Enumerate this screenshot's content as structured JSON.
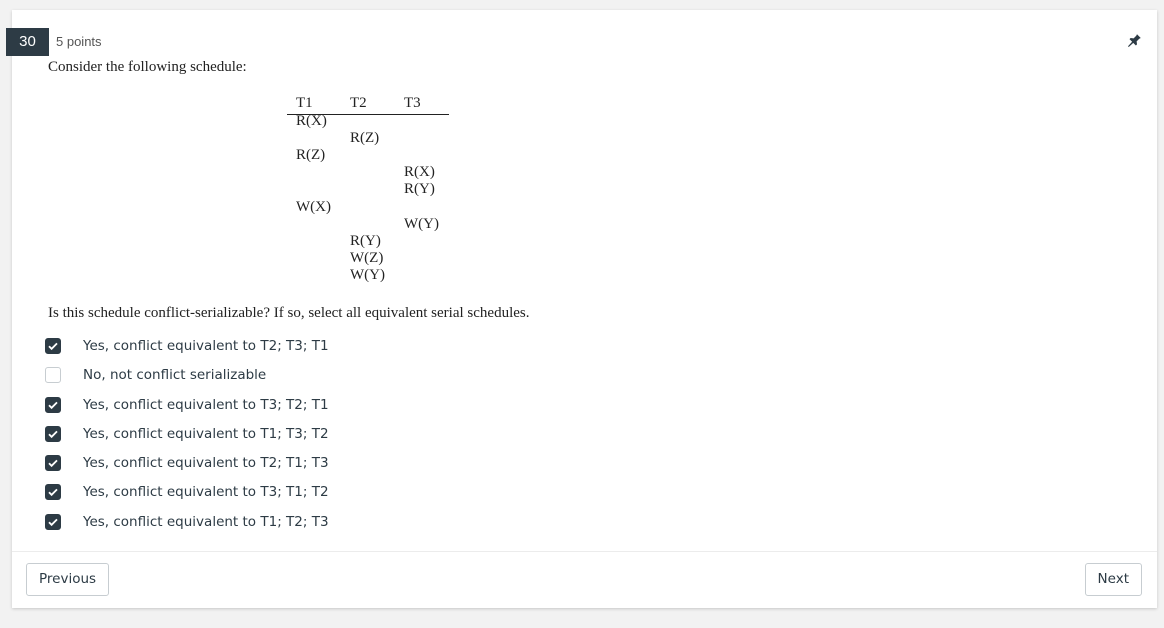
{
  "question": {
    "number": "30",
    "points": "5 points",
    "prompt": "Consider the following schedule:",
    "text": "Is this schedule conflict-serializable? If so, select all equivalent serial schedules."
  },
  "schedule": {
    "transactions": [
      "T1",
      "T2",
      "T3"
    ],
    "operations": [
      {
        "txn": "T1",
        "op": "R(X)"
      },
      {
        "txn": "T2",
        "op": "R(Z)"
      },
      {
        "txn": "T1",
        "op": "R(Z)"
      },
      {
        "txn": "T3",
        "op": "R(X)"
      },
      {
        "txn": "T3",
        "op": "R(Y)"
      },
      {
        "txn": "T1",
        "op": "W(X)"
      },
      {
        "txn": "T3",
        "op": "W(Y)"
      },
      {
        "txn": "T2",
        "op": "R(Y)"
      },
      {
        "txn": "T2",
        "op": "W(Z)"
      },
      {
        "txn": "T2",
        "op": "W(Y)"
      }
    ]
  },
  "options": [
    {
      "label": "Yes, conflict equivalent to T2; T3; T1",
      "checked": true
    },
    {
      "label": "No, not conflict serializable",
      "checked": false
    },
    {
      "label": "Yes, conflict equivalent to T3; T2; T1",
      "checked": true
    },
    {
      "label": "Yes, conflict equivalent to T1; T3; T2",
      "checked": true
    },
    {
      "label": "Yes, conflict equivalent to T2; T1; T3",
      "checked": true
    },
    {
      "label": "Yes, conflict equivalent to T3; T1; T2",
      "checked": true
    },
    {
      "label": "Yes, conflict equivalent to T1; T2; T3",
      "checked": true
    }
  ],
  "nav": {
    "previous_label": "Previous",
    "next_label": "Next"
  },
  "icons": {
    "pin": "pin-icon",
    "check": "check-icon"
  },
  "colors": {
    "accent": "#2d3b45",
    "background": "#f2f2f2",
    "card": "#ffffff"
  }
}
